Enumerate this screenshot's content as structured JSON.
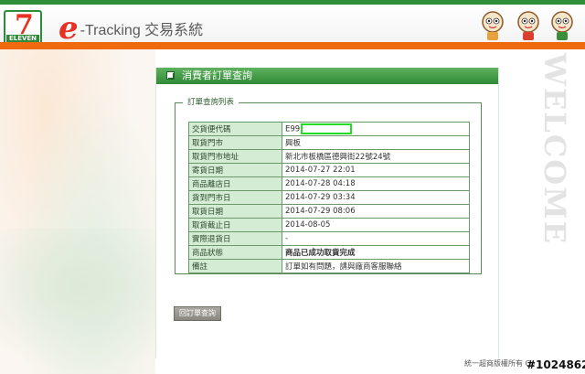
{
  "header": {
    "logo_digit": "7",
    "logo_text": "ELEVEN",
    "brand_letter": "e",
    "brand_rest": "-Tracking 交易系統",
    "colors": {
      "green": "#2f8f3a",
      "orange": "#ef6a0f",
      "red": "#e73223"
    }
  },
  "side_text": "WELCOME",
  "panel": {
    "title": "消費者訂單查詢",
    "legend": "訂單查詢列表",
    "rows": [
      {
        "label": "交貨便代碼",
        "value": "E99"
      },
      {
        "label": "取貨門市",
        "value": "興板"
      },
      {
        "label": "取貨門市地址",
        "value": "新北市板橋區德興街22號24號"
      },
      {
        "label": "寄貨日期",
        "value": "2014-07-27 22:01"
      },
      {
        "label": "商品離店日",
        "value": "2014-07-28 04:18"
      },
      {
        "label": "貨到門市日",
        "value": "2014-07-29 03:34"
      },
      {
        "label": "取貨日期",
        "value": "2014-07-29 08:06"
      },
      {
        "label": "取貨截止日",
        "value": "2014-08-05"
      },
      {
        "label": "實際退貨日",
        "value": "-"
      },
      {
        "label": "商品狀態",
        "value": "商品已成功取貨完成"
      },
      {
        "label": "備註",
        "value": "訂單如有問題，請與廠商客服聯絡"
      }
    ],
    "back_button": "回訂單查詢"
  },
  "footer": {
    "copyright": "統一超商版權所有 Co",
    "watermark": "#1024862"
  }
}
